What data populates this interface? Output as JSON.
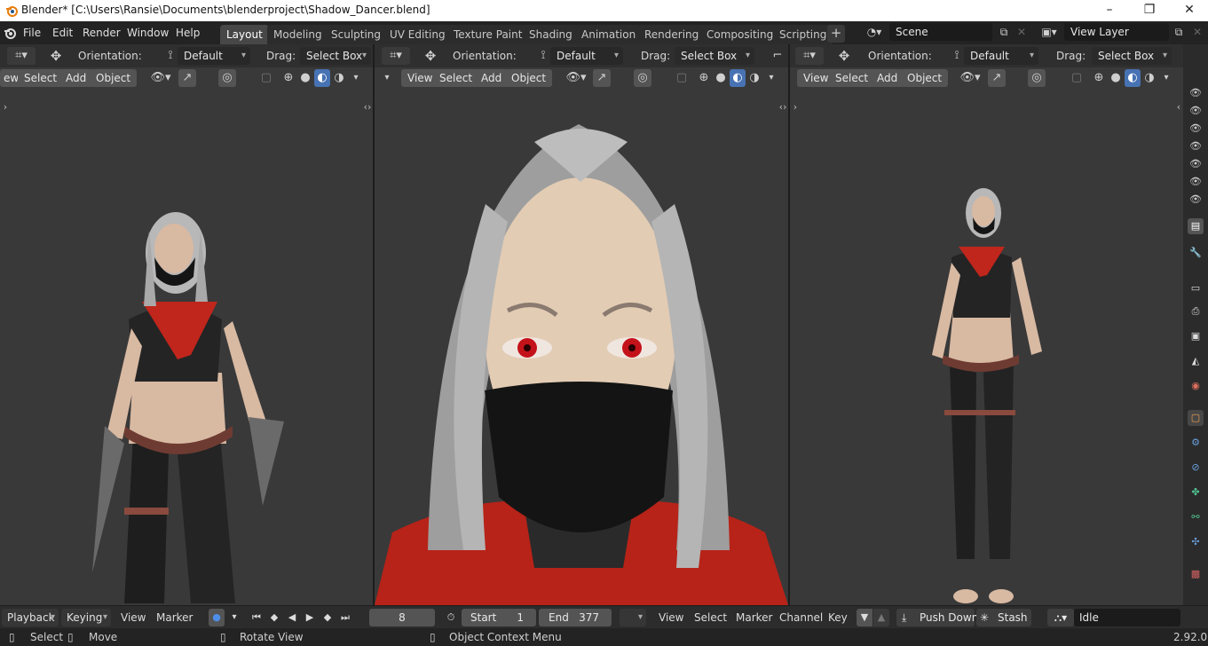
{
  "window": {
    "title": "Blender* [C:\\Users\\Ransie\\Documents\\blenderproject\\Shadow_Dancer.blend]",
    "controls": [
      "–",
      "❐",
      "✕"
    ]
  },
  "menu": [
    "File",
    "Edit",
    "Render",
    "Window",
    "Help"
  ],
  "workspaces": [
    {
      "label": "Layout",
      "active": true
    },
    {
      "label": "Modeling"
    },
    {
      "label": "Sculpting"
    },
    {
      "label": "UV Editing"
    },
    {
      "label": "Texture Paint"
    },
    {
      "label": "Shading"
    },
    {
      "label": "Animation"
    },
    {
      "label": "Rendering"
    },
    {
      "label": "Compositing"
    },
    {
      "label": "Scripting"
    }
  ],
  "workspace_add": "+",
  "scene": {
    "name": "Scene"
  },
  "view_layer": {
    "name": "View Layer"
  },
  "viewports": [
    {
      "orientation_label": "Orientation:",
      "orientation": "Default",
      "drag_label": "Drag:",
      "drag": "Select Box",
      "menus": [
        "ew",
        "Select",
        "Add",
        "Object"
      ]
    },
    {
      "orientation_label": "Orientation:",
      "orientation": "Default",
      "drag_label": "Drag:",
      "drag": "Select Box",
      "menus": [
        "View",
        "Select",
        "Add",
        "Object"
      ]
    },
    {
      "orientation_label": "Orientation:",
      "orientation": "Default",
      "drag_label": "Drag:",
      "drag": "Select Box",
      "menus": [
        "View",
        "Select",
        "Add",
        "Object"
      ]
    }
  ],
  "timeline": {
    "playback": "Playback",
    "keying": "Keying",
    "view": "View",
    "marker": "Marker",
    "current_frame": "8",
    "start_label": "Start",
    "start": "1",
    "end_label": "End",
    "end": "377",
    "menus": [
      "View",
      "Select",
      "Marker",
      "Channel",
      "Key"
    ],
    "push_down": "Push Down",
    "stash": "Stash",
    "action_state": "Idle"
  },
  "statusbar": {
    "select": "Select",
    "move": "Move",
    "rotate_view": "Rotate View",
    "context_menu": "Object Context Menu",
    "version": "2.92.0"
  },
  "colors": {
    "accent": "#4772b3",
    "active_tab": "#474747",
    "viewport_bg": "#393939"
  }
}
